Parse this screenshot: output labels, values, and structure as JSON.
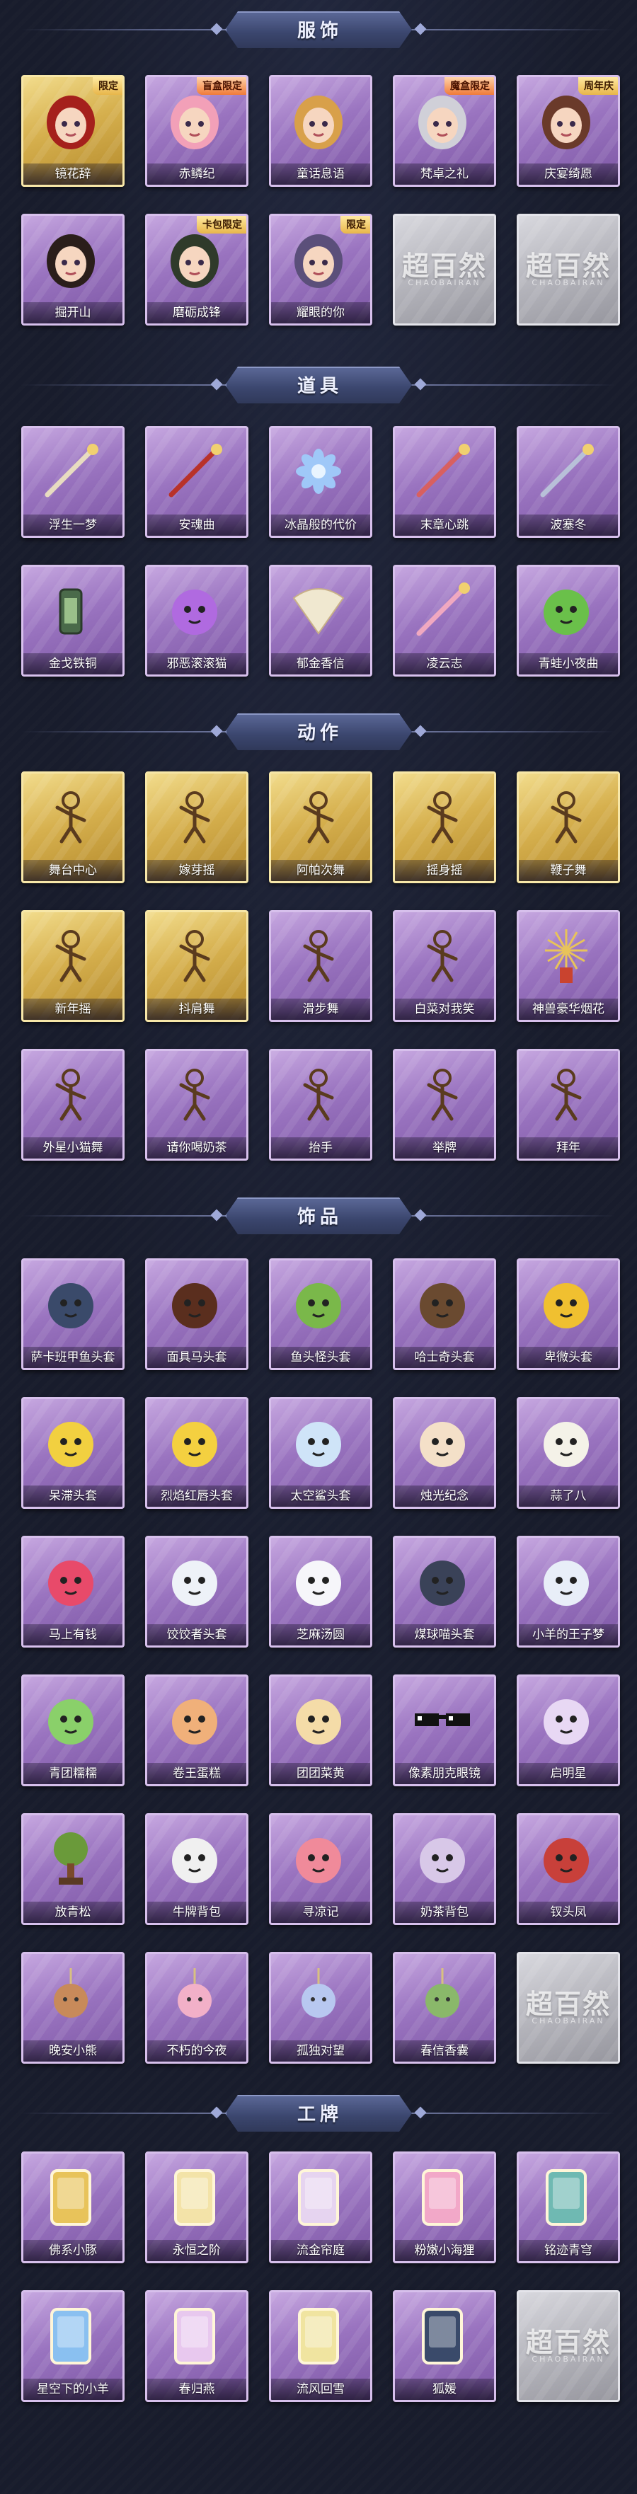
{
  "sections": [
    {
      "title": "服饰",
      "items": [
        {
          "name": "镜花辞",
          "rarity": "gold",
          "icon": "hooded-girl-costume",
          "tag": "限定"
        },
        {
          "name": "赤鳞纪",
          "rarity": "purple",
          "icon": "pink-hair-girl-costume",
          "tag": "盲盒限定"
        },
        {
          "name": "童话息语",
          "rarity": "purple",
          "icon": "blonde-girl-costume"
        },
        {
          "name": "梵卓之礼",
          "rarity": "purple",
          "icon": "vampire-costume",
          "tag": "魔盒限定"
        },
        {
          "name": "庆宴绮愿",
          "rarity": "purple",
          "icon": "feast-costume",
          "tag": "周年庆"
        },
        {
          "name": "掘开山",
          "rarity": "purple",
          "icon": "dark-hair-boy-costume"
        },
        {
          "name": "磨砺成锋",
          "rarity": "purple",
          "icon": "green-robe-costume",
          "tag": "卡包限定"
        },
        {
          "name": "耀眼的你",
          "rarity": "purple",
          "icon": "witch-hat-costume",
          "tag": "限定"
        },
        {
          "name": "",
          "rarity": "gray",
          "icon": "placeholder",
          "placeholder": "超百然"
        },
        {
          "name": "",
          "rarity": "gray",
          "icon": "placeholder",
          "placeholder": "超百然"
        }
      ]
    },
    {
      "title": "道具",
      "items": [
        {
          "name": "浮生一梦",
          "rarity": "purple",
          "icon": "scroll-icon"
        },
        {
          "name": "安魂曲",
          "rarity": "purple",
          "icon": "red-staff-icon"
        },
        {
          "name": "冰晶般的代价",
          "rarity": "purple",
          "icon": "ice-flower-icon"
        },
        {
          "name": "末章心跳",
          "rarity": "purple",
          "icon": "wand-icon"
        },
        {
          "name": "波塞冬",
          "rarity": "purple",
          "icon": "trident-icon"
        },
        {
          "name": "金戈铁铜",
          "rarity": "purple",
          "icon": "lantern-icon"
        },
        {
          "name": "邪恶滚滚猫",
          "rarity": "purple",
          "icon": "purple-cat-icon"
        },
        {
          "name": "郁金香信",
          "rarity": "purple",
          "icon": "fan-icon"
        },
        {
          "name": "凌云志",
          "rarity": "purple",
          "icon": "kite-icon"
        },
        {
          "name": "青蛙小夜曲",
          "rarity": "purple",
          "icon": "frog-icon"
        }
      ]
    },
    {
      "title": "动作",
      "items": [
        {
          "name": "舞台中心",
          "rarity": "gold",
          "icon": "pose-icon"
        },
        {
          "name": "嫁芽摇",
          "rarity": "gold",
          "icon": "pose-icon"
        },
        {
          "name": "阿帕次舞",
          "rarity": "gold",
          "icon": "pose-icon"
        },
        {
          "name": "摇身摇",
          "rarity": "gold",
          "icon": "pose-icon"
        },
        {
          "name": "鞭子舞",
          "rarity": "gold",
          "icon": "pose-icon"
        },
        {
          "name": "新年摇",
          "rarity": "gold",
          "icon": "pose-icon"
        },
        {
          "name": "抖肩舞",
          "rarity": "gold",
          "icon": "pose-icon"
        },
        {
          "name": "滑步舞",
          "rarity": "purple",
          "icon": "pose-icon"
        },
        {
          "name": "白菜对我笑",
          "rarity": "purple",
          "icon": "pose-icon"
        },
        {
          "name": "神兽豪华烟花",
          "rarity": "purple",
          "icon": "firework-icon"
        },
        {
          "name": "外星小猫舞",
          "rarity": "purple",
          "icon": "pose-icon"
        },
        {
          "name": "请你喝奶茶",
          "rarity": "purple",
          "icon": "pose-icon"
        },
        {
          "name": "抬手",
          "rarity": "purple",
          "icon": "pose-icon"
        },
        {
          "name": "举牌",
          "rarity": "purple",
          "icon": "pose-icon"
        },
        {
          "name": "拜年",
          "rarity": "purple",
          "icon": "pose-icon"
        }
      ]
    },
    {
      "title": "饰品",
      "items": [
        {
          "name": "萨卡班甲鱼头套",
          "rarity": "purple",
          "icon": "fish-head-icon"
        },
        {
          "name": "面具马头套",
          "rarity": "purple",
          "icon": "horse-head-icon"
        },
        {
          "name": "鱼头怪头套",
          "rarity": "purple",
          "icon": "green-fish-head-icon"
        },
        {
          "name": "哈士奇头套",
          "rarity": "purple",
          "icon": "husky-head-icon"
        },
        {
          "name": "卑微头套",
          "rarity": "purple",
          "icon": "yellow-emoji-icon"
        },
        {
          "name": "呆滞头套",
          "rarity": "purple",
          "icon": "dazed-emoji-icon"
        },
        {
          "name": "烈焰红唇头套",
          "rarity": "purple",
          "icon": "pikachu-head-icon"
        },
        {
          "name": "太空鲨头套",
          "rarity": "purple",
          "icon": "shark-egg-icon"
        },
        {
          "name": "烛光纪念",
          "rarity": "purple",
          "icon": "candle-icon"
        },
        {
          "name": "蒜了八",
          "rarity": "purple",
          "icon": "garlic-icon"
        },
        {
          "name": "马上有钱",
          "rarity": "purple",
          "icon": "pink-horse-icon"
        },
        {
          "name": "饺饺者头套",
          "rarity": "purple",
          "icon": "dumpling-icon"
        },
        {
          "name": "芝麻汤圆",
          "rarity": "purple",
          "icon": "tangyuan-icon"
        },
        {
          "name": "煤球喵头套",
          "rarity": "purple",
          "icon": "black-cat-icon"
        },
        {
          "name": "小羊的王子梦",
          "rarity": "purple",
          "icon": "sheep-prince-icon"
        },
        {
          "name": "青团糯糯",
          "rarity": "purple",
          "icon": "green-dumpling-icon"
        },
        {
          "name": "卷王蛋糕",
          "rarity": "purple",
          "icon": "cake-roll-icon"
        },
        {
          "name": "团团菜黄",
          "rarity": "purple",
          "icon": "bun-cat-icon"
        },
        {
          "name": "像素朋克眼镜",
          "rarity": "purple",
          "icon": "pixel-glasses-icon"
        },
        {
          "name": "启明星",
          "rarity": "purple",
          "icon": "star-halo-icon"
        },
        {
          "name": "放青松",
          "rarity": "purple",
          "icon": "pine-tree-icon"
        },
        {
          "name": "牛牌背包",
          "rarity": "purple",
          "icon": "cow-backpack-icon"
        },
        {
          "name": "寻凉记",
          "rarity": "purple",
          "icon": "straw-hat-icon"
        },
        {
          "name": "奶茶背包",
          "rarity": "purple",
          "icon": "milktea-bag-icon"
        },
        {
          "name": "钗头凤",
          "rarity": "purple",
          "icon": "phoenix-crown-icon"
        },
        {
          "name": "晚安小熊",
          "rarity": "purple",
          "icon": "bear-charm-icon"
        },
        {
          "name": "不朽的今夜",
          "rarity": "purple",
          "icon": "pink-charm-icon"
        },
        {
          "name": "孤独对望",
          "rarity": "purple",
          "icon": "doll-charm-icon"
        },
        {
          "name": "春信香囊",
          "rarity": "purple",
          "icon": "sachet-icon"
        },
        {
          "name": "",
          "rarity": "gray",
          "icon": "placeholder",
          "placeholder": "超百然"
        }
      ]
    },
    {
      "title": "工牌",
      "items": [
        {
          "name": "佛系小豚",
          "rarity": "purple",
          "icon": "badge-gold-icon"
        },
        {
          "name": "永恒之阶",
          "rarity": "purple",
          "icon": "badge-crown-icon"
        },
        {
          "name": "流金帘庭",
          "rarity": "purple",
          "icon": "badge-frame-icon"
        },
        {
          "name": "粉嫩小海狸",
          "rarity": "purple",
          "icon": "badge-pink-icon"
        },
        {
          "name": "铭迹青穹",
          "rarity": "purple",
          "icon": "badge-teal-icon"
        },
        {
          "name": "星空下的小羊",
          "rarity": "purple",
          "icon": "badge-blue-icon"
        },
        {
          "name": "春归燕",
          "rarity": "purple",
          "icon": "badge-lilac-icon"
        },
        {
          "name": "流风回雪",
          "rarity": "purple",
          "icon": "badge-yellow-icon"
        },
        {
          "name": "狐媛",
          "rarity": "purple",
          "icon": "badge-dark-icon"
        },
        {
          "name": "",
          "rarity": "gray",
          "icon": "placeholder",
          "placeholder": "超百然"
        }
      ]
    }
  ],
  "colors": {
    "background": "#181c2c",
    "purple_card": "#9a74c0",
    "gold_card": "#d6b04e",
    "gray_card": "#b5b5bc",
    "banner": "#3b466e"
  },
  "placeholder_subtitle": "CHAOBAIRAN"
}
